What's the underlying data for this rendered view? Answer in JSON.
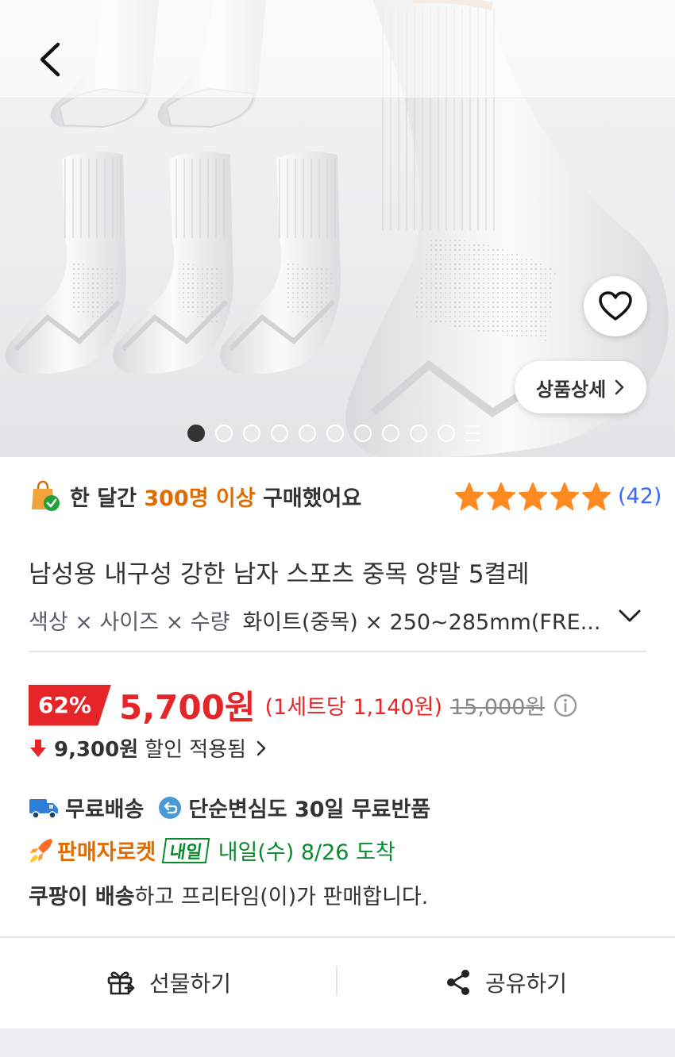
{
  "icons": {
    "back": "chevron-left-icon",
    "wishlist": "heart-icon",
    "detail_arrow": "chevron-right-icon",
    "purchase_bag": "shopping-bag-check-icon",
    "rating_star": "star-icon",
    "option_expand": "chevron-down-icon",
    "price_info": "info-icon",
    "price_down": "arrow-down-icon",
    "coupon_arrow": "chevron-right-icon",
    "free_shipping": "truck-icon",
    "free_return": "return-icon",
    "rocket": "rocket-icon",
    "gift": "gift-icon",
    "share": "share-icon"
  },
  "colors": {
    "accent_red": "#e52528",
    "orange_highlight": "#e06c00",
    "star": "#ff8a1f",
    "link_blue": "#346aff",
    "delivery_green": "#0a8a2f"
  },
  "gallery": {
    "detail_label": "상품상세",
    "total_images": 10,
    "active_index": 1
  },
  "purchase_info": {
    "prefix": "한 달간",
    "highlight": "300명 이상",
    "suffix": "구매했어요"
  },
  "rating": {
    "stars": 5,
    "count": "(42)"
  },
  "product": {
    "title": "남성용 내구성 강한 남자 스포츠 중목 양말 5켤레",
    "option_label": "색상 × 사이즈 × 수량",
    "option_value": "화이트(중목) × 250~285mm(FRE..."
  },
  "price": {
    "discount_rate": "62%",
    "sale_price": "5,700원",
    "unit_price": "(1세트당 1,140원)",
    "original_price": "15,000원",
    "coupon_amount": "9,300원",
    "coupon_text": "할인 적용됨"
  },
  "shipping": {
    "free_shipping": "무료배송",
    "free_return": "단순변심도 30일 무료반품",
    "rocket_label": "판매자로켓",
    "tomorrow_badge": "내일",
    "arrival": "내일(수) 8/26 도착",
    "seller_bold": "쿠팡이 배송",
    "seller_rest": "하고 프리타임(이)가 판매합니다."
  },
  "actions": {
    "gift": "선물하기",
    "share": "공유하기"
  }
}
